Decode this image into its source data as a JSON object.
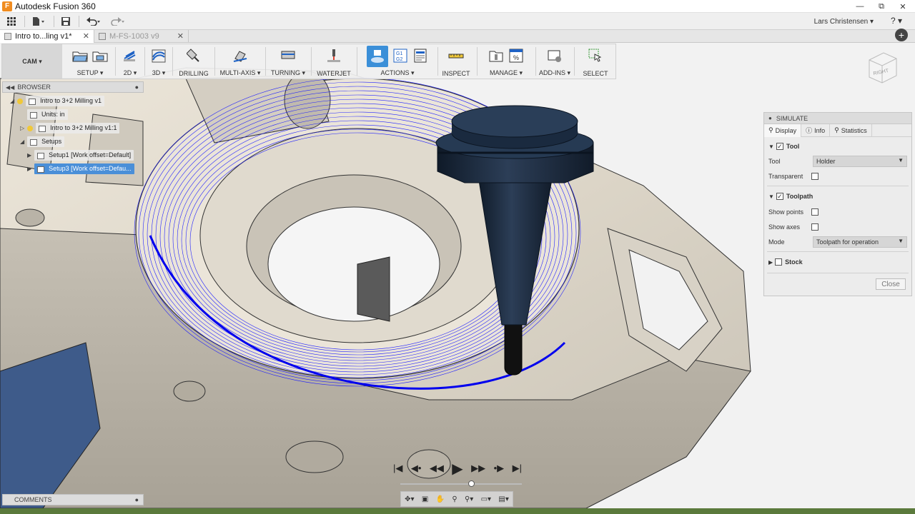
{
  "app": {
    "title": "Autodesk Fusion 360",
    "icon": "F"
  },
  "window": {
    "minimize": "—",
    "restore": "⧉",
    "close": "✕"
  },
  "quick_access": {
    "grid_icon": "grid-icon",
    "file_menu": "file-menu-icon",
    "save": "save-icon",
    "undo": "undo-icon",
    "redo": "redo-icon"
  },
  "user": {
    "name": "Lars Christensen ▾",
    "help": "? ▾"
  },
  "tabs": [
    {
      "label": "Intro to...ling v1*",
      "active": true
    },
    {
      "label": "M-FS-1003 v9",
      "active": false
    }
  ],
  "workspace": {
    "label": "CAM ▾"
  },
  "ribbon": {
    "groups": [
      {
        "label": "SETUP ▾"
      },
      {
        "label": "2D ▾"
      },
      {
        "label": "3D ▾"
      },
      {
        "label": "DRILLING"
      },
      {
        "label": "MULTI-AXIS ▾"
      },
      {
        "label": "TURNING ▾"
      },
      {
        "label": "WATERJET"
      },
      {
        "label": "ACTIONS ▾"
      },
      {
        "label": "INSPECT"
      },
      {
        "label": "MANAGE ▾"
      },
      {
        "label": "ADD-INS ▾"
      },
      {
        "label": "SELECT"
      }
    ],
    "gcode_icon_text": "G1\nG2"
  },
  "viewcube": {
    "face": "RIGHT"
  },
  "browser": {
    "title": "BROWSER",
    "items": [
      {
        "label": "Intro to 3+2 Milling v1"
      },
      {
        "label": "Units: in"
      },
      {
        "label": "Intro to 3+2 Milling v1:1"
      },
      {
        "label": "Setups"
      },
      {
        "label": "Setup1 [Work offset=Default]"
      },
      {
        "label": "Setup3 [Work offset=Defau..."
      }
    ]
  },
  "simulate": {
    "title": "SIMULATE",
    "tabs": [
      "Display",
      "Info",
      "Statistics"
    ],
    "tool_section": "Tool",
    "tool_label": "Tool",
    "tool_value": "Holder",
    "transparent_label": "Transparent",
    "toolpath_section": "Toolpath",
    "show_points_label": "Show points",
    "show_axes_label": "Show axes",
    "mode_label": "Mode",
    "mode_value": "Toolpath for operation",
    "stock_section": "Stock",
    "close_label": "Close"
  },
  "comments": {
    "title": "COMMENTS"
  },
  "playback": {
    "buttons": [
      "|◀",
      "◀•",
      "◀◀",
      "▶",
      "▶▶",
      "•▶",
      "▶|"
    ],
    "position": 0.58
  },
  "colors": {
    "toolpath": "#1a1aff",
    "tool": "#1d2b3e",
    "part": "#e6ddcf",
    "accent": "#0696d7"
  }
}
